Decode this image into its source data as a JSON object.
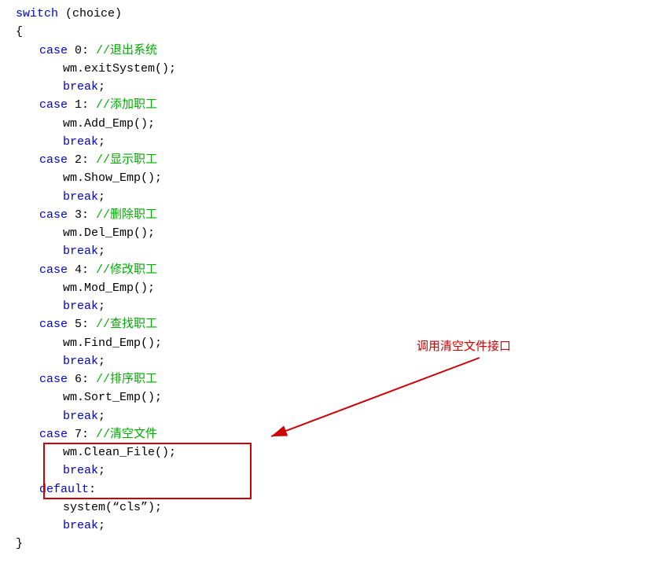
{
  "code": {
    "lines": [
      {
        "indent": 0,
        "tokens": [
          {
            "type": "kw",
            "text": "switch"
          },
          {
            "type": "fn",
            "text": " (choice)"
          }
        ]
      },
      {
        "indent": 0,
        "tokens": [
          {
            "type": "bracket",
            "text": "{"
          }
        ]
      },
      {
        "indent": 1,
        "tokens": [
          {
            "type": "kw",
            "text": "case"
          },
          {
            "type": "fn",
            "text": " 0: "
          },
          {
            "type": "comment-zh",
            "text": "//退出系统"
          }
        ]
      },
      {
        "indent": 2,
        "tokens": [
          {
            "type": "fn",
            "text": "wm.exitSystem();"
          }
        ]
      },
      {
        "indent": 2,
        "tokens": [
          {
            "type": "kw",
            "text": "break"
          },
          {
            "type": "fn",
            "text": ";"
          }
        ]
      },
      {
        "indent": 1,
        "tokens": [
          {
            "type": "kw",
            "text": "case"
          },
          {
            "type": "fn",
            "text": " 1: "
          },
          {
            "type": "comment-zh",
            "text": "//添加职工"
          }
        ]
      },
      {
        "indent": 2,
        "tokens": [
          {
            "type": "fn",
            "text": "wm.Add_Emp();"
          }
        ]
      },
      {
        "indent": 2,
        "tokens": [
          {
            "type": "kw",
            "text": "break"
          },
          {
            "type": "fn",
            "text": ";"
          }
        ]
      },
      {
        "indent": 1,
        "tokens": [
          {
            "type": "kw",
            "text": "case"
          },
          {
            "type": "fn",
            "text": " 2: "
          },
          {
            "type": "comment-zh",
            "text": "//显示职工"
          }
        ]
      },
      {
        "indent": 2,
        "tokens": [
          {
            "type": "fn",
            "text": "wm.Show_Emp();"
          }
        ]
      },
      {
        "indent": 2,
        "tokens": [
          {
            "type": "kw",
            "text": "break"
          },
          {
            "type": "fn",
            "text": ";"
          }
        ]
      },
      {
        "indent": 1,
        "tokens": [
          {
            "type": "kw",
            "text": "case"
          },
          {
            "type": "fn",
            "text": " 3: "
          },
          {
            "type": "comment-zh",
            "text": "//删除职工"
          }
        ]
      },
      {
        "indent": 2,
        "tokens": [
          {
            "type": "fn",
            "text": "wm.Del_Emp();"
          }
        ]
      },
      {
        "indent": 2,
        "tokens": [
          {
            "type": "kw",
            "text": "break"
          },
          {
            "type": "fn",
            "text": ";"
          }
        ]
      },
      {
        "indent": 1,
        "tokens": [
          {
            "type": "kw",
            "text": "case"
          },
          {
            "type": "fn",
            "text": " 4: "
          },
          {
            "type": "comment-zh",
            "text": "//修改职工"
          }
        ]
      },
      {
        "indent": 2,
        "tokens": [
          {
            "type": "fn",
            "text": "wm.Mod_Emp();"
          }
        ]
      },
      {
        "indent": 2,
        "tokens": [
          {
            "type": "kw",
            "text": "break"
          },
          {
            "type": "fn",
            "text": ";"
          }
        ]
      },
      {
        "indent": 1,
        "tokens": [
          {
            "type": "kw",
            "text": "case"
          },
          {
            "type": "fn",
            "text": " 5: "
          },
          {
            "type": "comment-zh",
            "text": "//查找职工"
          }
        ]
      },
      {
        "indent": 2,
        "tokens": [
          {
            "type": "fn",
            "text": "wm.Find_Emp();"
          }
        ]
      },
      {
        "indent": 2,
        "tokens": [
          {
            "type": "kw",
            "text": "break"
          },
          {
            "type": "fn",
            "text": ";"
          }
        ]
      },
      {
        "indent": 1,
        "tokens": [
          {
            "type": "kw",
            "text": "case"
          },
          {
            "type": "fn",
            "text": " 6: "
          },
          {
            "type": "comment-zh",
            "text": "//排序职工"
          }
        ]
      },
      {
        "indent": 2,
        "tokens": [
          {
            "type": "fn",
            "text": "wm.Sort_Emp();"
          }
        ]
      },
      {
        "indent": 2,
        "tokens": [
          {
            "type": "kw",
            "text": "break"
          },
          {
            "type": "fn",
            "text": ";"
          }
        ]
      },
      {
        "indent": 1,
        "tokens": [
          {
            "type": "kw",
            "text": "case"
          },
          {
            "type": "fn",
            "text": " 7: "
          },
          {
            "type": "comment-zh",
            "text": "//清空文件"
          }
        ]
      },
      {
        "indent": 2,
        "tokens": [
          {
            "type": "fn",
            "text": "wm.Clean_File();"
          }
        ]
      },
      {
        "indent": 2,
        "tokens": [
          {
            "type": "kw",
            "text": "break"
          },
          {
            "type": "fn",
            "text": ";"
          }
        ]
      },
      {
        "indent": 1,
        "tokens": [
          {
            "type": "kw",
            "text": "default"
          },
          {
            "type": "fn",
            "text": ":"
          }
        ]
      },
      {
        "indent": 2,
        "tokens": [
          {
            "type": "fn",
            "text": "system("
          },
          {
            "type": "fn",
            "text": "“cls”"
          },
          {
            "type": "fn",
            "text": ");"
          }
        ]
      },
      {
        "indent": 2,
        "tokens": [
          {
            "type": "kw",
            "text": "break"
          },
          {
            "type": "fn",
            "text": ";"
          }
        ]
      },
      {
        "indent": 0,
        "tokens": [
          {
            "type": "bracket",
            "text": "}"
          }
        ]
      }
    ]
  },
  "annotation": {
    "text": "调用清空文件接口",
    "color": "#cc0000"
  }
}
